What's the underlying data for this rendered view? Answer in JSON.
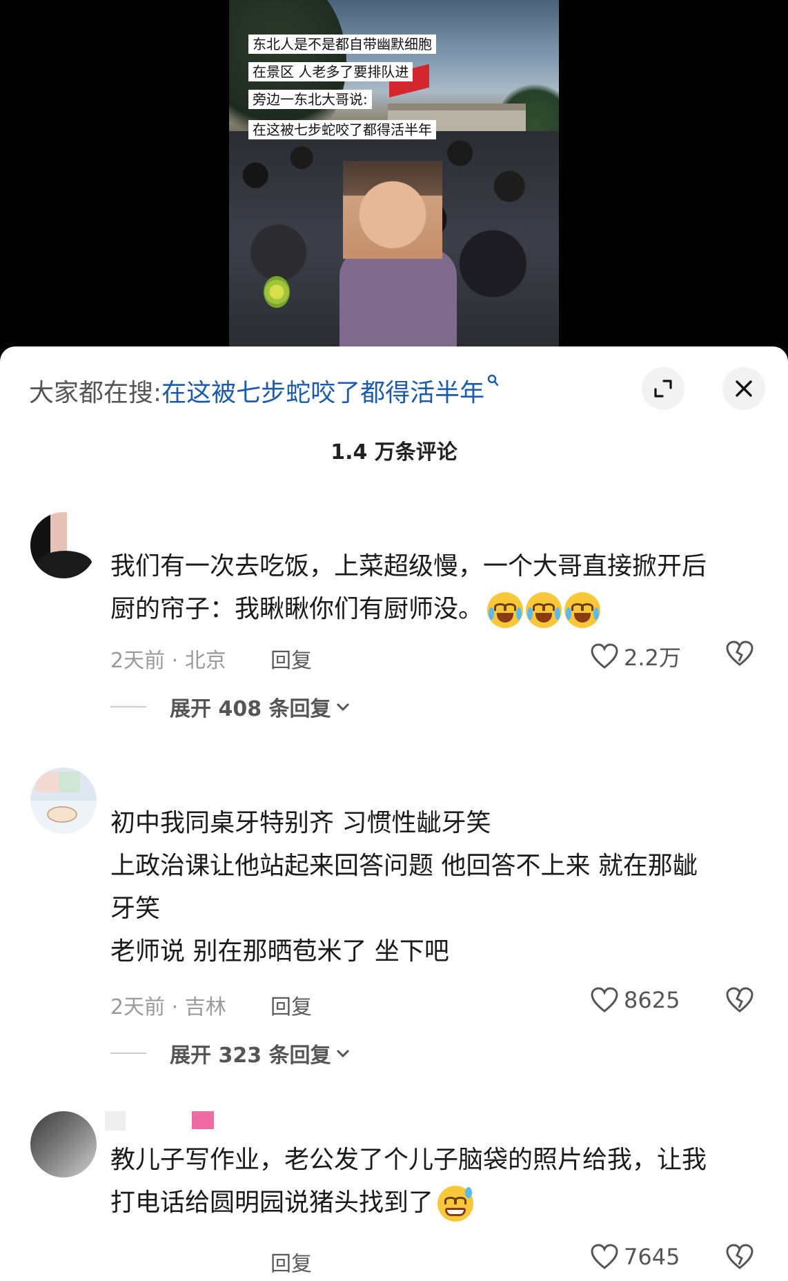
{
  "video": {
    "captions": [
      "东北人是不是都自带幽默细胞",
      "在景区 人老多了要排队进",
      "旁边一东北大哥说:",
      "在这被七步蛇咬了都得活半年"
    ]
  },
  "search": {
    "prefix": "大家都在搜:",
    "query": "在这被七步蛇咬了都得活半年",
    "icon": "search-icon"
  },
  "header": {
    "comment_count": "1.4 万条评论",
    "expand_icon": "expand-icon",
    "close_icon": "close-icon"
  },
  "comments": [
    {
      "username": "",
      "lines": [
        "我们有一次去吃饭，上菜超级慢，一个大哥直接掀开后",
        "厨的帘子：我瞅瞅你们有厨师没。"
      ],
      "emojis": [
        "crying-laughing-emoji",
        "crying-laughing-emoji",
        "crying-laughing-emoji"
      ],
      "meta": "2天前 · 北京",
      "reply_label": "回复",
      "likes": "2.2万",
      "expand_label": "展开 408 条回复"
    },
    {
      "username": "",
      "lines": [
        "初中我同桌牙特别齐 习惯性龇牙笑",
        "上政治课让他站起来回答问题 他回答不上来  就在那龇",
        "牙笑",
        "老师说 别在那晒苞米了 坐下吧"
      ],
      "emojis": [],
      "meta": "2天前 · 吉林",
      "reply_label": "回复",
      "likes": "8625",
      "expand_label": "展开 323 条回复"
    },
    {
      "username": "",
      "lines": [
        "教儿子写作业，老公发了个儿子脑袋的照片给我，让我",
        "打电话给圆明园说猪头找到了"
      ],
      "emojis": [
        "grimacing-sweat-emoji"
      ],
      "meta": "",
      "reply_label": "回复",
      "likes": "7645",
      "expand_label": ""
    }
  ],
  "colors": {
    "search_query": "#1c5ba8",
    "sheet_bg": "#ffffff",
    "meta_gray": "#9a9a9a"
  }
}
